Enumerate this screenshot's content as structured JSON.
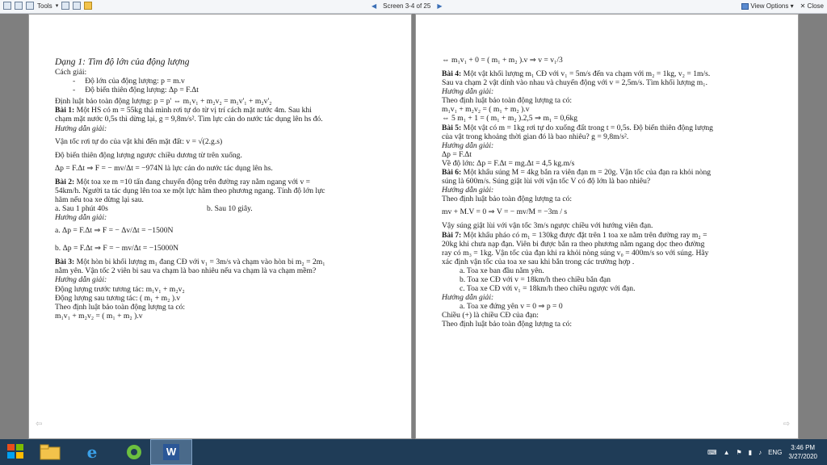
{
  "toolbar": {
    "tools_label": "Tools",
    "screen_indicator": "Screen 3-4 of 25",
    "view_options_label": "View Options",
    "close_label": "Close"
  },
  "left_page": {
    "title": "Dạng 1: Tìm độ lớn của động lượng",
    "lines": [
      "Cách giải:",
      "Độ lớn của động lượng: p = m.v",
      "Độ biến thiên động lượng: Δp = F.Δt",
      "Định luật bảo toàn động lượng: p = p' ⇔ m₁v₁ + m₂v₂ = m₁v'₁ + m₂v'₂",
      "Bài 1: Một HS có m = 55kg thả mình rơi tự do từ vị trí cách mặt nước 4m. Sau khi",
      "chạm mặt nước 0,5s thì dừng lại, g = 9,8m/s². Tìm lực cản do nước tác dụng lên hs đó.",
      "Hướng dẫn giải:",
      "Vận tốc rơi tự do của vật khi đến mặt đất: v = √(2.g.s)",
      "Độ biến thiên động lượng ngược chiều dương từ trên xuống.",
      "Δp = F.Δt ⇒ F = − mv/Δt = −974N  là lực cản do nước tác dụng lên hs.",
      "Bài 2: Một toa xe  m =10 tấn đang chuyển động trên đường ray nằm ngang với v =",
      "54km/h. Người ta tác dụng lên toa xe một lực hãm theo phương ngang. Tính độ lớn lực",
      "hãm nếu toa xe dừng lại sau.",
      "a. Sau 1 phút 40s",
      "b. Sau 10 giây.",
      "Hướng dẫn giải:",
      "a.  Δp = F.Δt ⇒ F = − Δv/Δt = −1500N",
      "b.  Δp = F.Δt ⇒ F = − mv/Δt = −15000N",
      "Bài 3: Một hòn bi khối lượng m₁ đang CĐ với v₁ = 3m/s và chạm vào hòn bi m₂ = 2m₁",
      "nằm yên. Vận tốc 2 viên bi sau va chạm là bao nhiêu nếu  va chạm là va chạm mềm?",
      "Hướng dẫn giải:",
      "Động lượng trước tương tác: m₁v₁ + m₂v₂",
      "Động lượng sau tương tác: ( m₁ + m₂ ).v",
      "Theo định luật bảo toàn động lượng ta có:",
      "m₁v₁ + m₂v₂ = ( m₁ + m₂ ).v"
    ]
  },
  "right_page": {
    "lines": [
      "⇔  m₁v₁ + 0 = ( m₁ + m₂ ).v  ⇒ v = v₁/3",
      "Bài 4: Một vật khối lượng m₁ CĐ với v₁ = 5m/s đến va chạm với m₂ = 1kg, v₂ = 1m/s.",
      "Sau va chạm 2 vật dính vào nhau và chuyển động với v = 2,5m/s. Tìm khối lượng m₁.",
      "Hướng dẫn giải:",
      "Theo định luật bảo toàn động lượng ta có:",
      "m₁v₁ + m₂v₂ = ( m₁ + m₂ ).v",
      "⇔ 5 m₁ + 1 = ( m₁ + m₂ ).2,5  ⇒ m₁ = 0,6kg",
      "Bài 5: Một vật có m = 1kg rơi tự do xuống đất trong t = 0,5s. Độ biến thiên động lượng",
      "của vật trong khoảng thời gian đó là bao nhiêu? g = 9,8m/s².",
      "Hướng dẫn giải:",
      "Δp = F.Δt",
      "Về độ lớn:  Δp = F.Δt = mg.Δt = 4,5 kg.m/s",
      "Bài 6: Một khẩu súng M = 4kg bắn ra viên đạn m = 20g. Vận tốc của đạn ra khỏi nòng",
      "súng là 600m/s. Súng giật lùi với vận tốc V có độ lớn là bao nhiêu?",
      "Hướng dẫn giải:",
      "Theo định luật bảo toàn động lượng ta có:",
      "mv + M.V = 0  ⇒ V = − mv/M = −3m / s",
      "Vậy súng giật lùi với vận tốc 3m/s ngược chiều với hướng viên đạn.",
      "Bài 7: Một khẩu pháo có m₁ = 130kg được đặt trên 1 toa xe nằm trên đường ray m₂ =",
      "20kg khi chưa nạp đạn. Viên bi được bắn ra theo phương nằm ngang dọc theo đường",
      "ray có m₃ = 1kg. Vận tốc của đạn khi ra khỏi nòng súng v₀ = 400m/s so với súng. Hãy",
      "xác định vận tốc của toa xe sau khi bắn trong các trường hợp .",
      "a.    Toa xe ban đầu nằm yên.",
      "b.    Toa xe CĐ với v = 18km/h theo chiều bắn đạn",
      "c.    Toa xe CĐ với v₁ = 18km/h theo chiều ngược với đạn.",
      "Hướng dẫn giải:",
      "a.    Toa xe đứng yên v = 0  ⇒ p = 0",
      "Chiều (+) là chiều CĐ của đạn:",
      "Theo định luật bảo toàn động lượng ta có:"
    ]
  },
  "taskbar": {
    "language": "ENG",
    "time": "3:46 PM",
    "date": "3/27/2020",
    "word_app": "W"
  }
}
